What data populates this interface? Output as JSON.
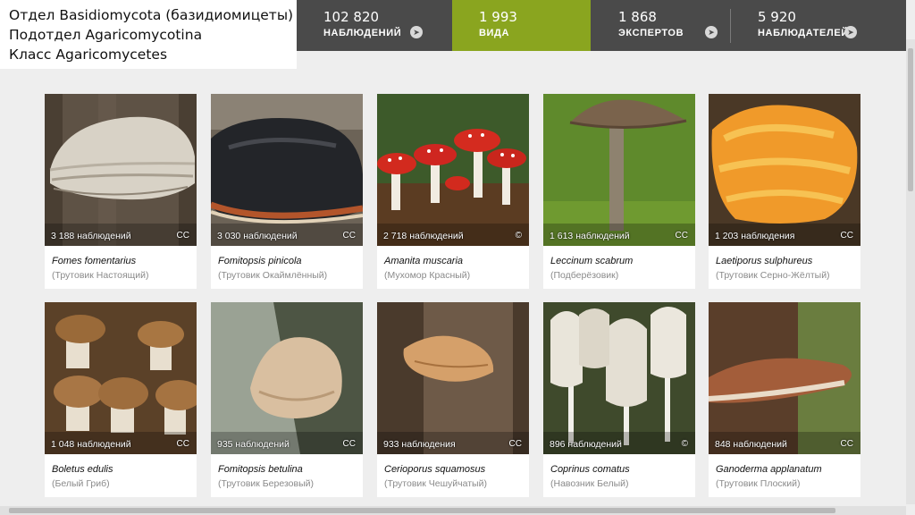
{
  "taxonomy": {
    "line1": "Отдел Basidiomycota (базидиомицеты)",
    "line2": "Подотдел Agaricomycotina",
    "line3": "Класс Agaricomycetes"
  },
  "stats": [
    {
      "number": "102 820",
      "label": "НАБЛЮДЕНИЙ"
    },
    {
      "number": "1 993",
      "label": "ВИДА"
    },
    {
      "number": "1 868",
      "label": "ЭКСПЕРТОВ"
    },
    {
      "number": "5 920",
      "label": "НАБЛЮДАТЕЛЕЙ"
    }
  ],
  "accent_color": "#8aa51f",
  "species": [
    {
      "observations": "3 188 наблюдений",
      "license": "CC",
      "latin": "Fomes fomentarius",
      "russian": "(Трутовик Настоящий)"
    },
    {
      "observations": "3 030 наблюдений",
      "license": "CC",
      "latin": "Fomitopsis pinicola",
      "russian": "(Трутовик Окаймлённый)"
    },
    {
      "observations": "2 718 наблюдений",
      "license": "©",
      "latin": "Amanita muscaria",
      "russian": "(Мухомор Красный)"
    },
    {
      "observations": "1 613 наблюдений",
      "license": "CC",
      "latin": "Leccinum scabrum",
      "russian": "(Подберёзовик)"
    },
    {
      "observations": "1 203 наблюдения",
      "license": "CC",
      "latin": "Laetiporus sulphureus",
      "russian": "(Трутовик Серно-Жёлтый)"
    },
    {
      "observations": "1 048 наблюдений",
      "license": "CC",
      "latin": "Boletus edulis",
      "russian": "(Белый Гриб)"
    },
    {
      "observations": "935 наблюдений",
      "license": "CC",
      "latin": "Fomitopsis betulina",
      "russian": "(Трутовик Березовый)"
    },
    {
      "observations": "933 наблюдения",
      "license": "CC",
      "latin": "Cerioporus squamosus",
      "russian": "(Трутовик Чешуйчатый)"
    },
    {
      "observations": "896 наблюдений",
      "license": "©",
      "latin": "Coprinus comatus",
      "russian": "(Навозник Белый)"
    },
    {
      "observations": "848 наблюдений",
      "license": "CC",
      "latin": "Ganoderma applanatum",
      "russian": "(Трутовик Плоский)"
    }
  ]
}
